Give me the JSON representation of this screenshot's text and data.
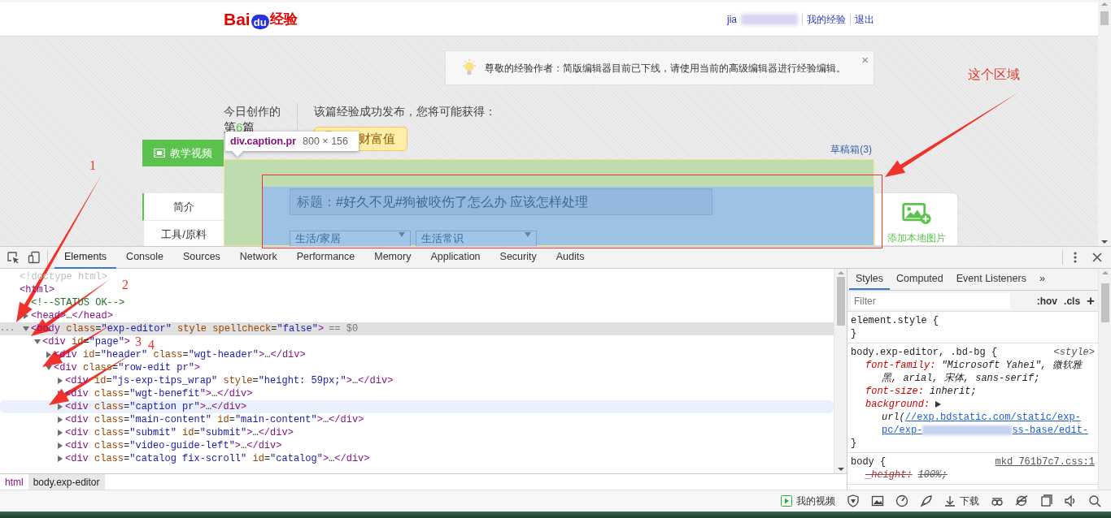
{
  "page": {
    "header": {
      "logo": {
        "latin": "Bai",
        "paw": "du",
        "cjk": "经验"
      },
      "user": "jia",
      "links": [
        {
          "text": "我的经验"
        },
        {
          "text": "退出"
        }
      ]
    },
    "tip": {
      "text": "尊敬的经验作者：简版编辑器目前已下线，请使用当前的高级编辑器进行经验编辑。",
      "close": "×"
    },
    "today": {
      "label": "今日创作的",
      "prefix": "第",
      "count": "6",
      "suffix": "篇"
    },
    "benefit": {
      "text": "该篇经验成功发布，您将可能获得：",
      "badge": "财富值"
    },
    "video_button": "教学视频",
    "drafts": "草稿箱(3)",
    "nav": [
      {
        "label": "简介",
        "selected": true
      },
      {
        "label": "工具/原料",
        "selected": false
      }
    ],
    "title_field": {
      "label": "标题：",
      "placeholder": "#好久不见#狗被咬伤了怎么办 应该怎样处理"
    },
    "category_selects": [
      {
        "value": "生活/家居"
      },
      {
        "value": "生活常识"
      }
    ],
    "add_image": "添加本地图片"
  },
  "inspect_tooltip": {
    "selector": "div.caption.pr",
    "size": "800 × 156"
  },
  "devtools": {
    "tabs": [
      {
        "label": "Elements",
        "selected": true
      },
      {
        "label": "Console",
        "selected": false
      },
      {
        "label": "Sources",
        "selected": false
      },
      {
        "label": "Network",
        "selected": false
      },
      {
        "label": "Performance",
        "selected": false
      },
      {
        "label": "Memory",
        "selected": false
      },
      {
        "label": "Application",
        "selected": false
      },
      {
        "label": "Security",
        "selected": false
      },
      {
        "label": "Audits",
        "selected": false
      }
    ],
    "tree": [
      {
        "text": "<!doctype html>",
        "kind": "doctype",
        "selected": false,
        "hovered": false
      },
      {
        "text": "<html>",
        "kind": "tag",
        "selected": false,
        "hovered": false,
        "children": [
          {
            "text": "<!--STATUS OK-->",
            "kind": "comment",
            "selected": false,
            "hovered": false
          },
          {
            "text": "<head>…</head>",
            "kind": "tag",
            "expanded": false,
            "selected": false,
            "hovered": false
          },
          {
            "text": "<body class=\"exp-editor\" style spellcheck=\"false\">",
            "kind": "tag",
            "expanded": true,
            "selected": true,
            "hovered": false,
            "gutter": "...",
            "suffix": "== $0",
            "children": [
              {
                "text": "<div id=\"page\">",
                "kind": "tag",
                "expanded": true,
                "selected": false,
                "hovered": false,
                "children": [
                  {
                    "text": "<div id=\"header\" class=\"wgt-header\">…</div>",
                    "kind": "tag",
                    "expanded": false,
                    "selected": false,
                    "hovered": false
                  },
                  {
                    "text": "<div class=\"row-edit pr\">",
                    "kind": "tag",
                    "expanded": true,
                    "selected": false,
                    "hovered": false,
                    "children": [
                      {
                        "text": "<div id=\"js-exp-tips_wrap\" style=\"height: 59px;\">…</div>",
                        "kind": "tag",
                        "expanded": false,
                        "selected": false,
                        "hovered": false
                      },
                      {
                        "text": "<div class=\"wgt-benefit\">…</div>",
                        "kind": "tag",
                        "expanded": false,
                        "selected": false,
                        "hovered": false
                      },
                      {
                        "text": "<div class=\"caption pr\">…</div>",
                        "kind": "tag",
                        "expanded": false,
                        "selected": false,
                        "hovered": true
                      },
                      {
                        "text": "<div class=\"main-content\" id=\"main-content\">…</div>",
                        "kind": "tag",
                        "expanded": false,
                        "selected": false,
                        "hovered": false
                      },
                      {
                        "text": "<div class=\"submit\" id=\"submit\">…</div>",
                        "kind": "tag",
                        "expanded": false,
                        "selected": false,
                        "hovered": false
                      },
                      {
                        "text": "<div class=\"video-guide-left\">…</div>",
                        "kind": "tag",
                        "expanded": false,
                        "selected": false,
                        "hovered": false
                      },
                      {
                        "text": "<div class=\"catalog fix-scroll\" id=\"catalog\">…</div>",
                        "kind": "tag",
                        "expanded": false,
                        "selected": false,
                        "hovered": false
                      }
                    ]
                  }
                ]
              }
            ]
          }
        ]
      }
    ],
    "breadcrumbs": [
      {
        "text": "html",
        "selected": false
      },
      {
        "text": "body.exp-editor",
        "selected": true
      }
    ],
    "sidebar_tabs": [
      {
        "label": "Styles",
        "selected": true
      },
      {
        "label": "Computed",
        "selected": false
      },
      {
        "label": "Event Listeners",
        "selected": false
      }
    ],
    "sidebar_more": "»",
    "filter": {
      "placeholder": "Filter"
    },
    "hov": ":hov",
    "cls": ".cls",
    "add": "+",
    "rules": [
      {
        "selector": "element.style {",
        "close": "}"
      },
      {
        "selector": "body.exp-editor, .bd-bg {",
        "source": "<style>",
        "close": "}",
        "declarations": [
          {
            "prop": "font-family:",
            "value": "\"Microsoft Yahei\", 微软雅黑, arial, 宋体, sans-serif;",
            "overridden": false
          },
          {
            "prop": "font-size:",
            "value": "inherit;",
            "overridden": false
          },
          {
            "prop": "background:",
            "value_prefix": "url(",
            "links": [
              "//exp.bdstatic.com/static/exp-",
              "pc/exp-",
              "ss-base/edit-"
            ],
            "overridden": false
          }
        ]
      },
      {
        "selector": "body {",
        "source": "mkd_761b7c7.css:1",
        "declarations": [
          {
            "prop": "_height:",
            "value": "100%;",
            "overridden": true
          }
        ]
      }
    ]
  },
  "status_bar": {
    "video": "我的视频",
    "download": "下载"
  },
  "annotations": {
    "numbers": [
      "1",
      "2",
      "3",
      "4"
    ],
    "callout": "这个区域"
  }
}
